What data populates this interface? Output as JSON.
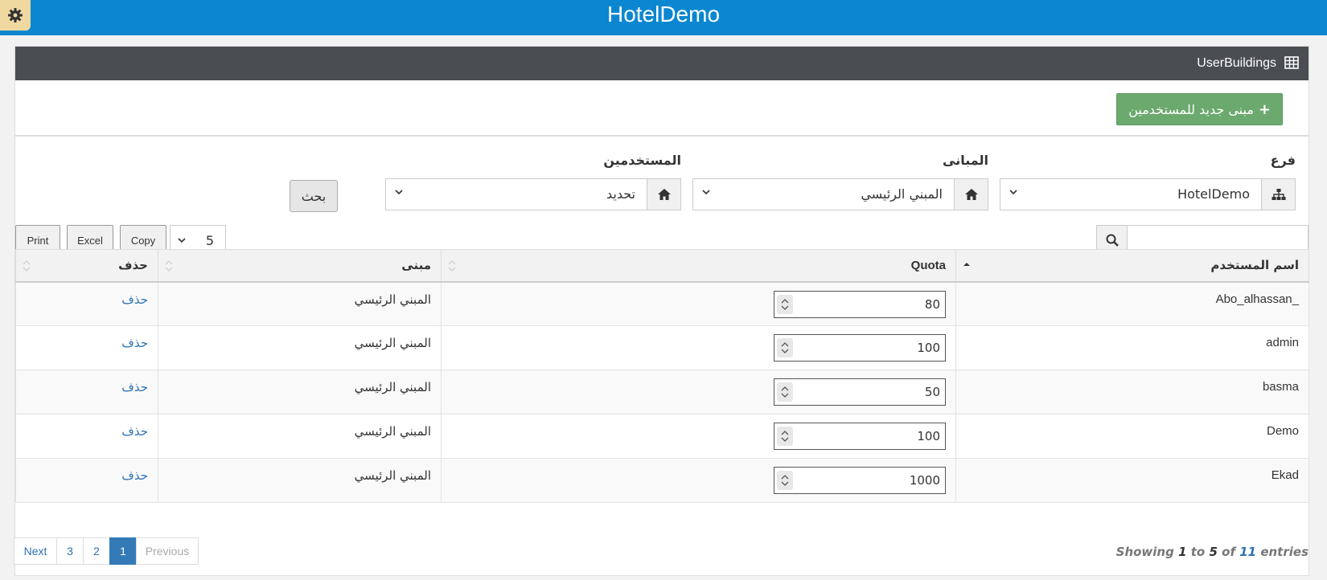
{
  "app": {
    "title": "HotelDemo"
  },
  "panel": {
    "title": "UserBuildings"
  },
  "toolbar": {
    "new_button": "مبنى جديد للمستخدمين"
  },
  "filters": {
    "branch": {
      "label": "فرع",
      "value": "HotelDemo"
    },
    "buildings": {
      "label": "المبانى",
      "value": "المبني الرئيسي"
    },
    "users": {
      "label": "المستخدمين",
      "value": "تحديد"
    },
    "search_button": "بحث"
  },
  "table_tools": {
    "print": "Print",
    "excel": "Excel",
    "copy": "Copy",
    "page_length": "5",
    "search_value": ""
  },
  "table": {
    "headers": {
      "username": "اسم المستخدم",
      "quota": "Quota",
      "building": "مبنى",
      "delete": "حذف"
    },
    "rows": [
      {
        "username": "Abo_alhassan_",
        "quota": "80",
        "building": "المبني الرئيسي",
        "delete": "حذف"
      },
      {
        "username": "admin",
        "quota": "100",
        "building": "المبني الرئيسي",
        "delete": "حذف"
      },
      {
        "username": "basma",
        "quota": "50",
        "building": "المبني الرئيسي",
        "delete": "حذف"
      },
      {
        "username": "Demo",
        "quota": "100",
        "building": "المبني الرئيسي",
        "delete": "حذف"
      },
      {
        "username": "Ekad",
        "quota": "1000",
        "building": "المبني الرئيسي",
        "delete": "حذف"
      }
    ]
  },
  "pagination": {
    "next": "Next",
    "pages": [
      "3",
      "2",
      "1"
    ],
    "active_page": "1",
    "previous": "Previous"
  },
  "info": {
    "prefix": "Showing",
    "from": "1",
    "to_word": "to",
    "to": "5",
    "of_word": "of",
    "total": "11",
    "suffix": "entries"
  },
  "colors": {
    "topbar": "#0a87d0",
    "panel_header": "#4a4d52",
    "success": "#6ba96e",
    "link": "#2a72b5"
  }
}
